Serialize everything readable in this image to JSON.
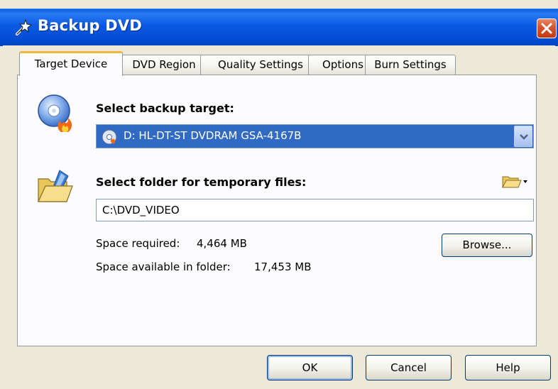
{
  "window": {
    "title": "Backup DVD",
    "app_icon": "wand-icon",
    "close_icon": "close-icon"
  },
  "tabs": [
    {
      "label": "Target Device",
      "active": true
    },
    {
      "label": "DVD Region",
      "active": false
    },
    {
      "label": "Quality Settings",
      "active": false
    },
    {
      "label": "Options",
      "active": false
    },
    {
      "label": "Burn Settings",
      "active": false
    }
  ],
  "target": {
    "heading": "Select backup target:",
    "icon": "dvd-burn-icon",
    "selected_device": "D: HL-DT-ST DVDRAM GSA-4167B",
    "device_icon": "disc-icon"
  },
  "temp_folder": {
    "heading": "Select folder for temporary files:",
    "icon": "open-folder-icon",
    "path": "C:\\DVD_VIDEO",
    "space_required_label": "Space required:",
    "space_required_value": "4,464 MB",
    "space_available_label": "Space available in folder:",
    "space_available_value": "17,453 MB",
    "browse_label": "Browse..."
  },
  "buttons": {
    "ok": "OK",
    "cancel": "Cancel",
    "help": "Help"
  },
  "colors": {
    "titlebar": "#0a58e2",
    "selection": "#316ac5",
    "active_tab_accent": "#f1b740",
    "window_bg": "#ece9d8"
  }
}
